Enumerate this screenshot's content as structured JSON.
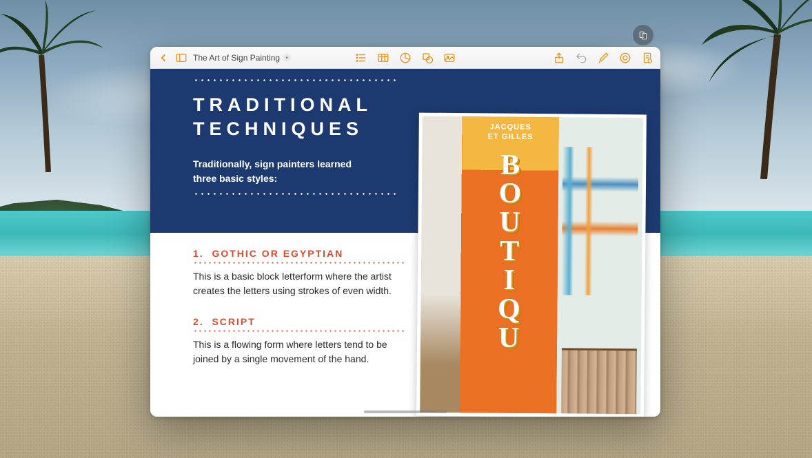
{
  "toolbar": {
    "doc_title": "The Art of Sign Painting"
  },
  "slide": {
    "heading_line1": "TRADITIONAL",
    "heading_line2": "TECHNIQUES",
    "subtext_line1": "Traditionally, sign painters learned",
    "subtext_line2": "three basic styles:",
    "sections": [
      {
        "number": "1.",
        "title": "GOTHIC OR EGYPTIAN",
        "body": "This is a basic block letterform where the artist creates the letters using strokes of even width."
      },
      {
        "number": "2.",
        "title": "SCRIPT",
        "body": "This is a flowing form where letters tend to be joined by a single movement of the hand."
      }
    ]
  },
  "photo": {
    "sign_top": "JACQUES\nET GILLES",
    "letters": [
      "B",
      "O",
      "U",
      "T",
      "I",
      "Q",
      "U"
    ]
  }
}
